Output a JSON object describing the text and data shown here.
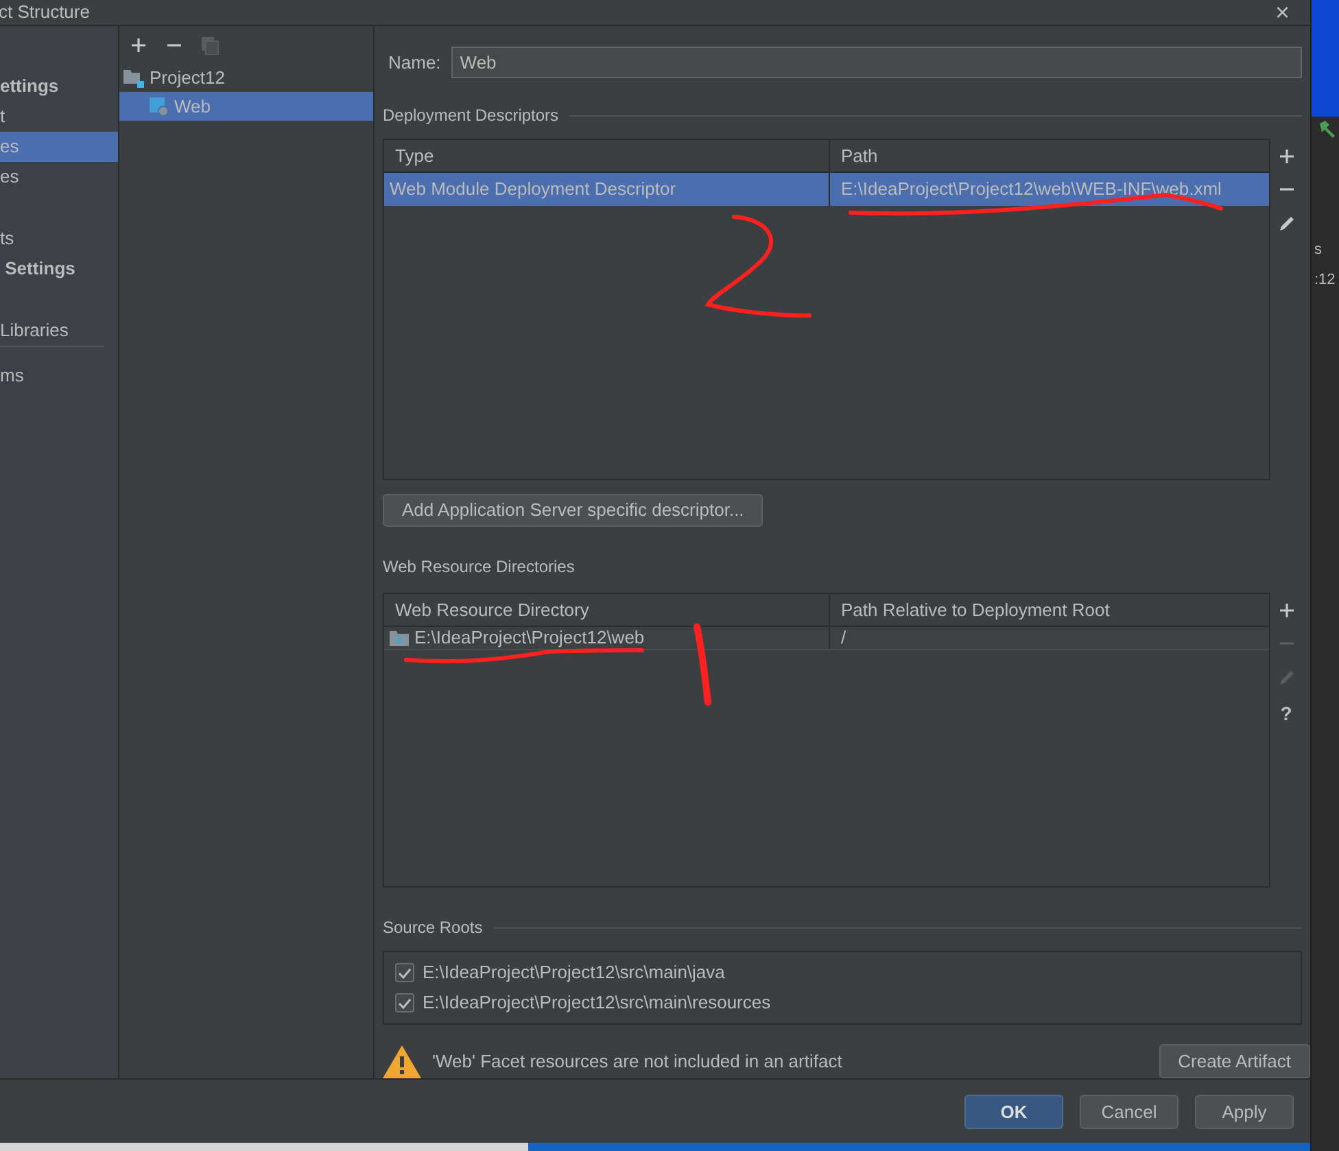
{
  "window": {
    "title": "ct Structure",
    "close": "×"
  },
  "sidebar": {
    "items": [
      {
        "label": "ettings",
        "kind": "header",
        "selected": false
      },
      {
        "label": "t",
        "kind": "item",
        "selected": false
      },
      {
        "label": "es",
        "kind": "item",
        "selected": true
      },
      {
        "label": "es",
        "kind": "item",
        "selected": false
      },
      {
        "label": "ts",
        "kind": "item",
        "selected": false
      },
      {
        "label": " Settings",
        "kind": "header",
        "selected": false
      },
      {
        "label": "Libraries",
        "kind": "item",
        "selected": false
      },
      {
        "label": "ms",
        "kind": "item",
        "selected": false
      }
    ]
  },
  "tree": {
    "items": [
      {
        "label": "Project12",
        "selected": false,
        "children": [
          {
            "label": "Web",
            "selected": true
          }
        ]
      }
    ]
  },
  "name_field": {
    "label": "Name:",
    "value": "Web"
  },
  "deployment_descriptors": {
    "title": "Deployment Descriptors",
    "columns": [
      "Type",
      "Path"
    ],
    "rows": [
      {
        "cells": [
          "Web Module Deployment Descriptor",
          "E:\\IdeaProject\\Project12\\web\\WEB-INF\\web.xml"
        ],
        "selected": true
      }
    ],
    "add_button": "Add Application Server specific descriptor..."
  },
  "web_resource_directories": {
    "title": "Web Resource Directories",
    "columns": [
      "Web Resource Directory",
      "Path Relative to Deployment Root"
    ],
    "rows": [
      {
        "cells": [
          "E:\\IdeaProject\\Project12\\web",
          "/"
        ],
        "selected": false
      }
    ],
    "help": "?"
  },
  "source_roots": {
    "title": "Source Roots",
    "items": [
      {
        "label": "E:\\IdeaProject\\Project12\\src\\main\\java",
        "checked": true
      },
      {
        "label": "E:\\IdeaProject\\Project12\\src\\main\\resources",
        "checked": true
      }
    ]
  },
  "warning": {
    "text": "'Web' Facet resources are not included in an artifact",
    "button": "Create Artifact"
  },
  "buttons": [
    "OK",
    "Cancel",
    "Apply"
  ],
  "background_ide": {
    "texts": [
      "s",
      ":12"
    ]
  }
}
